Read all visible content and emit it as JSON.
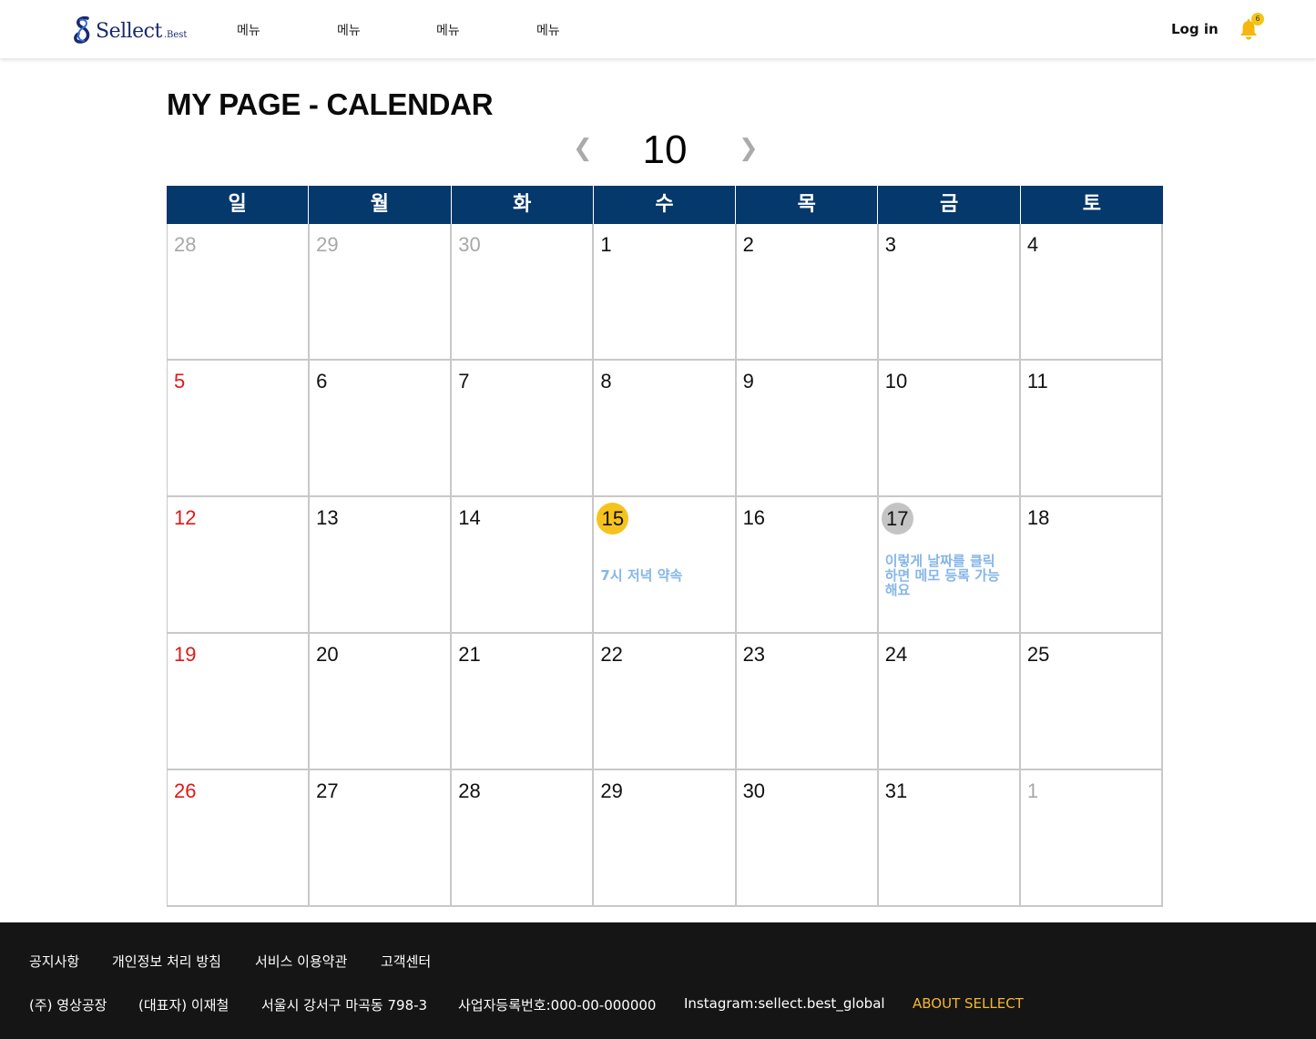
{
  "header": {
    "logo_text": "Sellect",
    "logo_sub": ".Best",
    "nav": [
      "메뉴",
      "메뉴",
      "메뉴",
      "메뉴"
    ],
    "login_label": "Log in",
    "notification_count": "6"
  },
  "page": {
    "title": "MY PAGE - CALENDAR",
    "month": "10",
    "prev_symbol": "❮",
    "next_symbol": "❯"
  },
  "calendar": {
    "weekdays": [
      "일",
      "월",
      "화",
      "수",
      "목",
      "금",
      "토"
    ],
    "weeks": [
      [
        {
          "day": "28",
          "state": "muted"
        },
        {
          "day": "29",
          "state": "muted"
        },
        {
          "day": "30",
          "state": "muted"
        },
        {
          "day": "1",
          "state": "normal"
        },
        {
          "day": "2",
          "state": "normal"
        },
        {
          "day": "3",
          "state": "normal"
        },
        {
          "day": "4",
          "state": "normal"
        }
      ],
      [
        {
          "day": "5",
          "state": "sunday"
        },
        {
          "day": "6",
          "state": "normal"
        },
        {
          "day": "7",
          "state": "normal"
        },
        {
          "day": "8",
          "state": "normal"
        },
        {
          "day": "9",
          "state": "normal"
        },
        {
          "day": "10",
          "state": "normal"
        },
        {
          "day": "11",
          "state": "normal"
        }
      ],
      [
        {
          "day": "12",
          "state": "sunday"
        },
        {
          "day": "13",
          "state": "normal"
        },
        {
          "day": "14",
          "state": "normal"
        },
        {
          "day": "15",
          "state": "today",
          "memo": "7시 저녁 약속"
        },
        {
          "day": "16",
          "state": "normal"
        },
        {
          "day": "17",
          "state": "selected",
          "memo": "이렇게 날짜를 클릭\n하면 메모 등록 가능\n해요"
        },
        {
          "day": "18",
          "state": "normal"
        }
      ],
      [
        {
          "day": "19",
          "state": "sunday"
        },
        {
          "day": "20",
          "state": "normal"
        },
        {
          "day": "21",
          "state": "normal"
        },
        {
          "day": "22",
          "state": "normal"
        },
        {
          "day": "23",
          "state": "normal"
        },
        {
          "day": "24",
          "state": "normal"
        },
        {
          "day": "25",
          "state": "normal"
        }
      ],
      [
        {
          "day": "26",
          "state": "sunday"
        },
        {
          "day": "27",
          "state": "normal"
        },
        {
          "day": "28",
          "state": "normal"
        },
        {
          "day": "29",
          "state": "normal"
        },
        {
          "day": "30",
          "state": "normal"
        },
        {
          "day": "31",
          "state": "normal"
        },
        {
          "day": "1",
          "state": "muted"
        }
      ]
    ]
  },
  "footer": {
    "links": [
      "공지사항",
      "개인정보 처리 방침",
      "서비스 이용약관",
      "고객센터"
    ],
    "company": "(주) 영상공장",
    "ceo": "(대표자) 이재철",
    "address": "서울시 강서구 마곡동 798-3",
    "business_number": "사업자등록번호:000-00-000000",
    "instagram": "Instagram:sellect.best_global",
    "about": "ABOUT SELLECT"
  },
  "colors": {
    "header_bar": "#05386b",
    "today_highlight": "#f6c21c",
    "selected_highlight": "#c4c4c4",
    "memo_text": "#86b6e8",
    "sunday_text": "#e11818",
    "footer_bg": "#151515",
    "about_link": "#f5b731"
  }
}
